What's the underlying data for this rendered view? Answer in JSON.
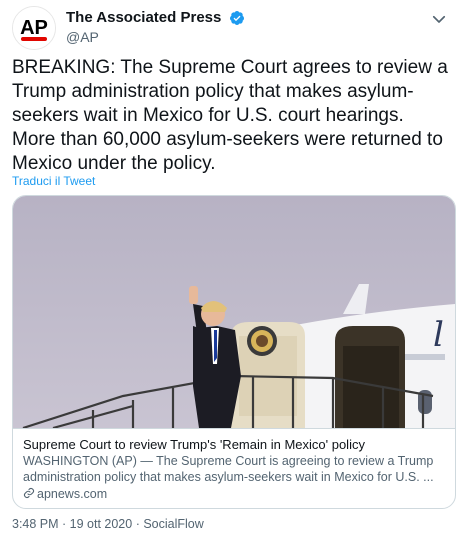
{
  "author": {
    "avatar_text": "AP",
    "display_name": "The Associated Press",
    "handle": "@AP",
    "verified": true,
    "avatar_text_color": "#000000",
    "avatar_accent": "#e10600"
  },
  "tweet": {
    "text": "BREAKING: The Supreme Court agrees to review a Trump administration policy that makes asylum-seekers wait in Mexico for U.S. court hearings. More than 60,000 asylum-seekers were returned to Mexico under the policy.",
    "translate_label": "Traduci il Tweet"
  },
  "card": {
    "title": "Supreme Court to review Trump's 'Remain in Mexico' policy",
    "description": "WASHINGTON (AP) — The Supreme Court is agreeing to review a Trump administration policy that makes asylum-seekers wait in Mexico for U.S. ...",
    "domain": "apnews.com"
  },
  "meta": {
    "text": "3:48 PM · 19 ott 2020 · SocialFlow"
  },
  "icons": {
    "verified": "verified-badge-icon",
    "more": "more-chevron-icon",
    "link": "link-icon"
  },
  "colors": {
    "accent": "#1d9bf0",
    "secondary_text": "#536471",
    "border": "#cfd9de"
  }
}
